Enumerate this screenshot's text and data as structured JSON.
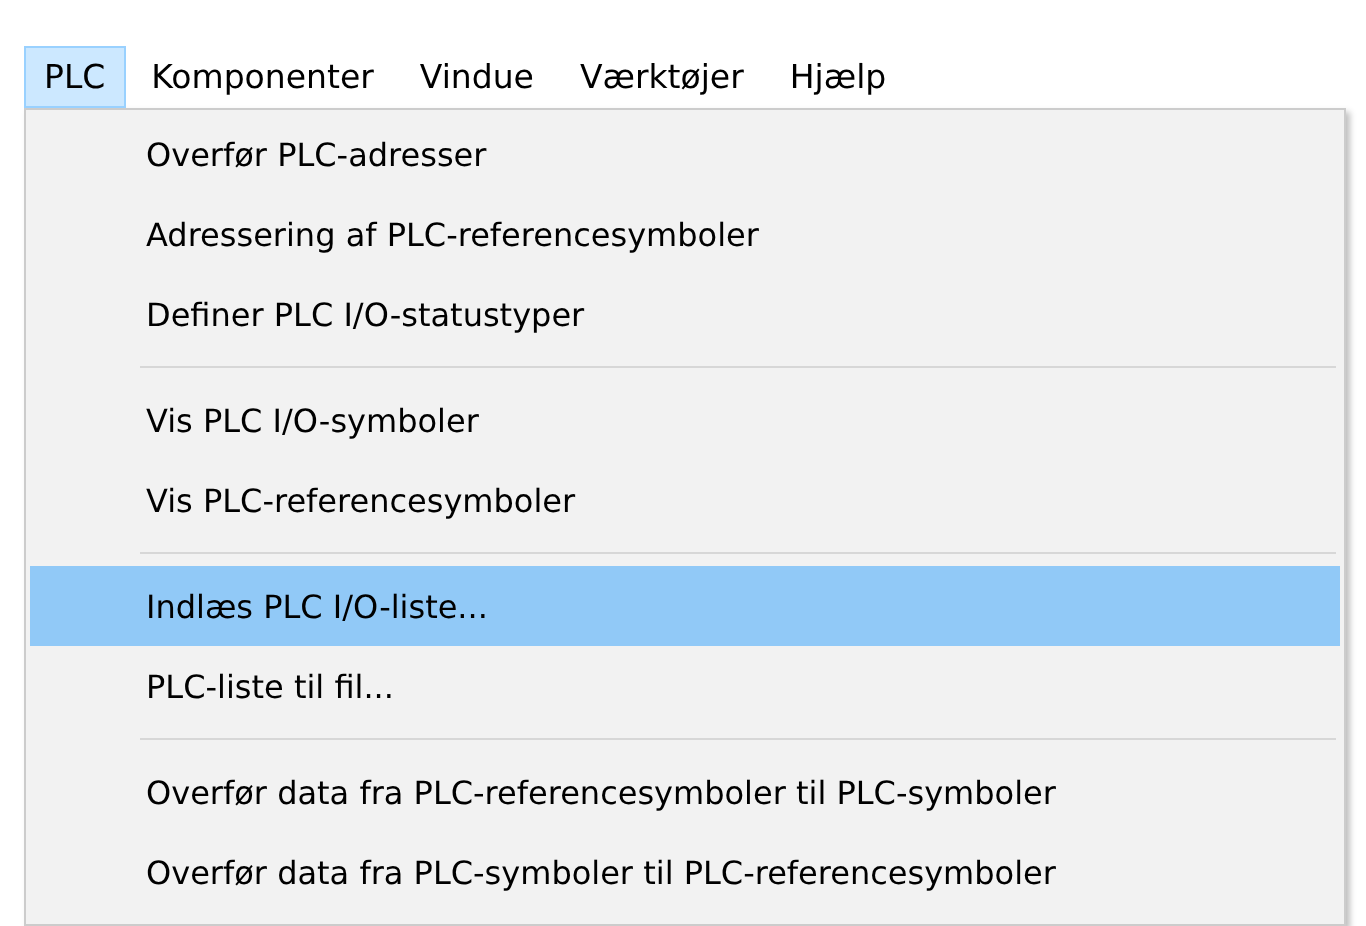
{
  "menubar": [
    {
      "label": "PLC",
      "selected": true
    },
    {
      "label": "Komponenter",
      "selected": false
    },
    {
      "label": "Vindue",
      "selected": false
    },
    {
      "label": "Værktøjer",
      "selected": false
    },
    {
      "label": "Hjælp",
      "selected": false
    }
  ],
  "menu": [
    {
      "kind": "item",
      "label": "Overfør PLC-adresser",
      "selected": false
    },
    {
      "kind": "item",
      "label": "Adressering af PLC-referencesymboler",
      "selected": false
    },
    {
      "kind": "item",
      "label": "Definer PLC I/O-statustyper",
      "selected": false
    },
    {
      "kind": "separator"
    },
    {
      "kind": "item",
      "label": "Vis PLC I/O-symboler",
      "selected": false
    },
    {
      "kind": "item",
      "label": "Vis PLC-referencesymboler",
      "selected": false
    },
    {
      "kind": "separator"
    },
    {
      "kind": "item",
      "label": "Indlæs PLC I/O-liste...",
      "selected": true
    },
    {
      "kind": "item",
      "label": "PLC-liste til fil...",
      "selected": false
    },
    {
      "kind": "separator"
    },
    {
      "kind": "item",
      "label": "Overfør data fra PLC-referencesymboler til PLC-symboler",
      "selected": false
    },
    {
      "kind": "item",
      "label": "Overfør data fra PLC-symboler til PLC-referencesymboler",
      "selected": false
    }
  ]
}
